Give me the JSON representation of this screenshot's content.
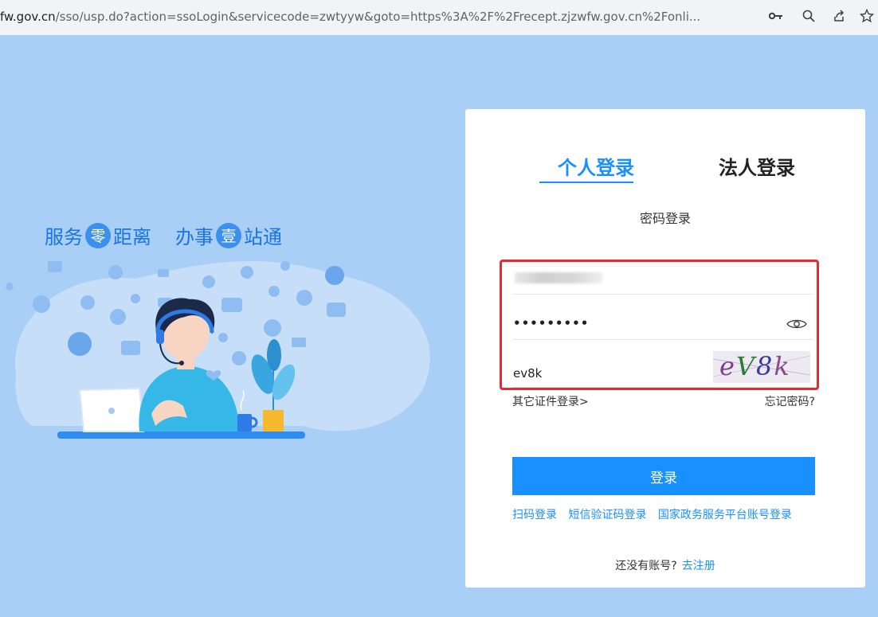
{
  "browser": {
    "url_host": "fw.gov.cn",
    "url_path": "/sso/usp.do?action=ssoLogin&servicecode=zwtyyw&goto=https%3A%2F%2Frecept.zjzwfw.gov.cn%2Fonli..."
  },
  "slogan": {
    "part1": "服务",
    "circle1": "零",
    "part2": "距离",
    "part3": "办事",
    "circle2": "壹",
    "part4": "站通"
  },
  "login": {
    "tab_personal": "个人登录",
    "tab_legal": "法人登录",
    "subtitle": "密码登录",
    "password_mask": "•••••••••",
    "captcha_value": "ev8k",
    "captcha_image_text": "eV8k",
    "other_cert_link": "其它证件登录>",
    "forgot_link": "忘记密码?",
    "submit_label": "登录",
    "alt_links": [
      "扫码登录",
      "短信验证码登录",
      "国家政务服务平台账号登录"
    ],
    "no_account_text": "还没有账号?",
    "register_link": "去注册"
  },
  "colors": {
    "accent": "#1890ff",
    "background": "#a9cff6",
    "highlight": "#e8292f"
  }
}
